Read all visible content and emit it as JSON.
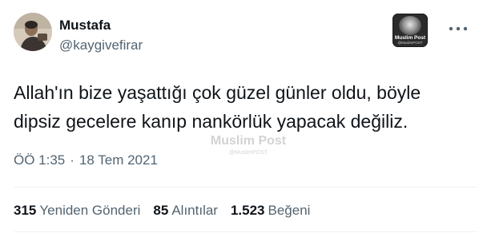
{
  "author": {
    "display_name": "Mustafa",
    "handle": "@kaygivefirar"
  },
  "watermark": {
    "logo_title": "Muslim Post",
    "logo_sub": "@MuslimPOST",
    "overlay_title": "Muslim Post",
    "overlay_sub": "@MuslimPOST"
  },
  "tweet": {
    "text": "Allah'ın bize yaşattığı çok güzel günler oldu, böyle\ndipsiz gecelere kanıp nankörlük yapacak değiliz.",
    "time": "ÖÖ 1:35",
    "separator": "·",
    "date": "18 Tem 2021"
  },
  "stats": {
    "retweets_count": "315",
    "retweets_label": "Yeniden Gönderi",
    "quotes_count": "85",
    "quotes_label": "Alıntılar",
    "likes_count": "1.523",
    "likes_label": "Beğeni"
  },
  "icons": {
    "more": "more-horizontal-icon",
    "avatar": "profile-photo"
  },
  "colors": {
    "primary_text": "#0f1419",
    "secondary_text": "#536471",
    "divider": "#eff3f4"
  }
}
